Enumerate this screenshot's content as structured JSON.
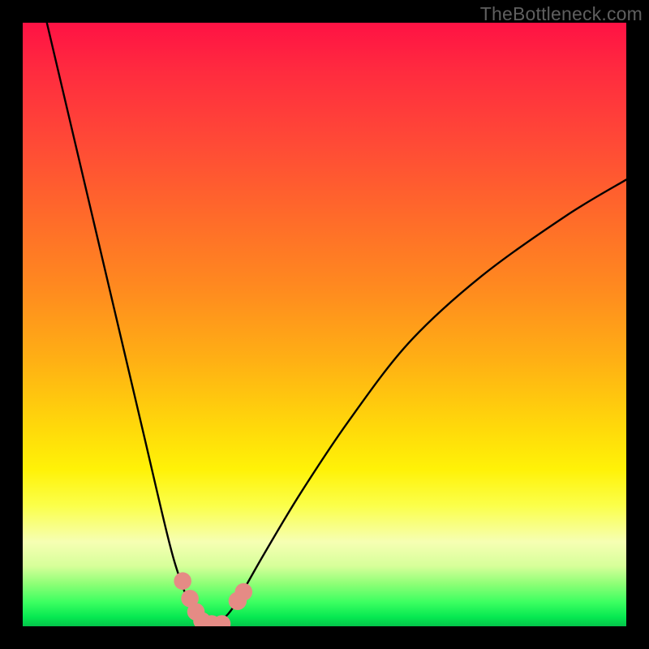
{
  "watermark": "TheBottleneck.com",
  "chart_data": {
    "type": "line",
    "title": "",
    "xlabel": "",
    "ylabel": "",
    "xlim": [
      0,
      100
    ],
    "ylim": [
      0,
      100
    ],
    "series": [
      {
        "name": "bottleneck-curve-left",
        "x": [
          4,
          8,
          12,
          16,
          20,
          24,
          26,
          28,
          29.5,
          30.5
        ],
        "y": [
          100,
          83,
          66,
          49,
          32,
          15,
          8,
          3,
          0.8,
          0
        ]
      },
      {
        "name": "bottleneck-curve-right",
        "x": [
          30.5,
          32,
          34,
          36,
          40,
          46,
          54,
          64,
          76,
          90,
          100
        ],
        "y": [
          0,
          0.5,
          2,
          5,
          12,
          22,
          34,
          47,
          58,
          68,
          74
        ]
      }
    ],
    "markers": {
      "name": "highlight-dots",
      "color": "#e58b85",
      "points": [
        {
          "x": 26.5,
          "y": 7.5,
          "r": 1.4
        },
        {
          "x": 27.7,
          "y": 4.6,
          "r": 1.4
        },
        {
          "x": 28.7,
          "y": 2.4,
          "r": 1.4
        },
        {
          "x": 29.7,
          "y": 0.9,
          "r": 1.4
        },
        {
          "x": 31.3,
          "y": 0.4,
          "r": 1.4
        },
        {
          "x": 33.0,
          "y": 0.4,
          "r": 1.4
        },
        {
          "x": 35.6,
          "y": 4.2,
          "r": 1.6
        },
        {
          "x": 36.6,
          "y": 5.7,
          "r": 1.4
        }
      ]
    },
    "gradient_stops": [
      {
        "pos": 0.0,
        "color": "#ff1244"
      },
      {
        "pos": 0.3,
        "color": "#ff6a2a"
      },
      {
        "pos": 0.6,
        "color": "#ffd50b"
      },
      {
        "pos": 0.8,
        "color": "#fbff4a"
      },
      {
        "pos": 0.96,
        "color": "#3cff61"
      },
      {
        "pos": 1.0,
        "color": "#04c44a"
      }
    ]
  }
}
